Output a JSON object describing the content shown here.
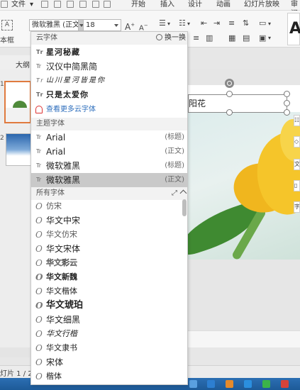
{
  "menubar": {
    "file_label": "文件",
    "items": [
      "开始",
      "插入",
      "设计",
      "动画",
      "幻灯片放映",
      "审阅"
    ]
  },
  "ribbon": {
    "font_name": "微软雅黑 (正文",
    "font_size": "18",
    "left_label": "本框",
    "big_a": "A"
  },
  "left_panel": {
    "tab_label": "大纲",
    "slide_num_1": "1",
    "slide_num_2": "2",
    "status": "灯片 1 / 2"
  },
  "canvas": {
    "textbox_text": "阳花"
  },
  "dropdown": {
    "cloud_section": {
      "title": "云字体",
      "swap_label": "换一换",
      "fonts": [
        "星河秘藏",
        "汉仪中简黑简",
        "山川星河皆是你",
        "只是太爱你"
      ],
      "more_link": "查看更多云字体"
    },
    "theme_section": {
      "title": "主题字体",
      "fonts": [
        {
          "name": "Arial",
          "tag": "(标题)"
        },
        {
          "name": "Arial",
          "tag": "(正文)"
        },
        {
          "name": "微软雅黑",
          "tag": "(标题)"
        },
        {
          "name": "微软雅黑",
          "tag": "(正文)"
        }
      ]
    },
    "all_section": {
      "title": "所有字体",
      "fonts": [
        "仿宋",
        "华文中宋",
        "华文仿宋",
        "华文宋体",
        "华文彩云",
        "华文新魏",
        "华文楷体",
        "华文琥珀",
        "华文细黑",
        "华文行楷",
        "华文隶书",
        "宋体",
        "楷体"
      ]
    }
  },
  "colors": {
    "accent_orange": "#e07a3e",
    "link_blue": "#2f6fbd",
    "highlight_gray": "#c9c9c9",
    "taskbar_blue": "#2c6fb3"
  }
}
